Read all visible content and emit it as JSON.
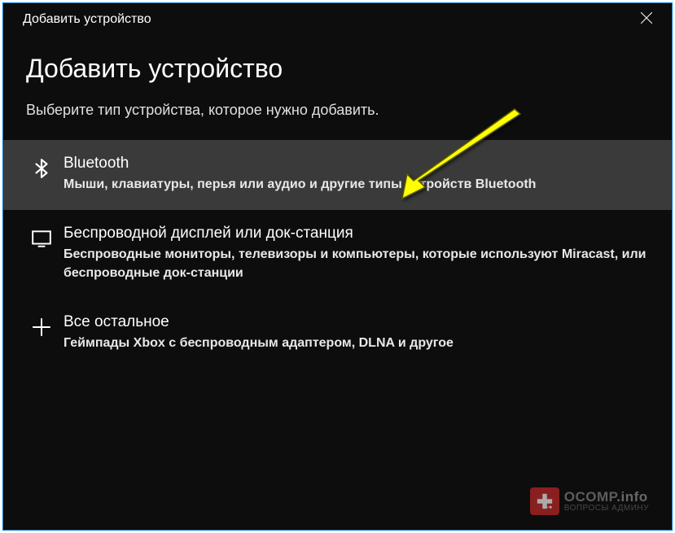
{
  "titlebar": {
    "title": "Добавить устройство"
  },
  "page": {
    "title": "Добавить устройство",
    "subtitle": "Выберите тип устройства, которое нужно добавить."
  },
  "devices": [
    {
      "icon": "bluetooth",
      "title": "Bluetooth",
      "description": "Мыши, клавиатуры, перья или аудио и другие типы устройств Bluetooth",
      "hovered": true
    },
    {
      "icon": "display",
      "title": "Беспроводной дисплей или док-станция",
      "description": "Беспроводные мониторы, телевизоры и компьютеры, которые используют Miracast, или беспроводные док-станции",
      "hovered": false
    },
    {
      "icon": "plus",
      "title": "Все остальное",
      "description": "Геймпады Xbox с беспроводным адаптером, DLNA и другое",
      "hovered": false
    }
  ],
  "watermark": {
    "brand": "OCOMP",
    "domain": ".info",
    "tagline": "ВОПРОСЫ АДМИНУ"
  },
  "colors": {
    "accent": "#0078d7",
    "hover": "#3a3a3a",
    "arrow": "#ffff00",
    "watermark_badge": "#cc2a2a"
  }
}
